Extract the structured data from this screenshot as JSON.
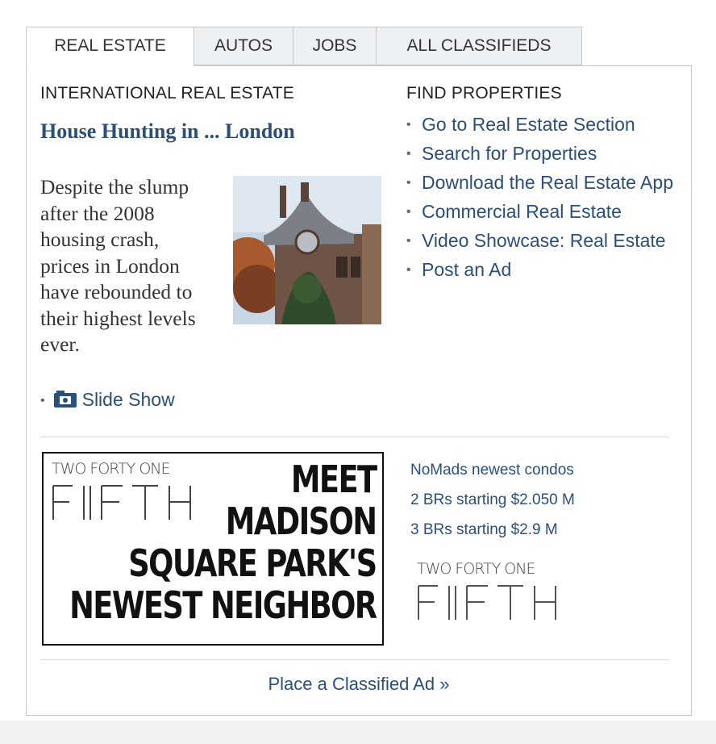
{
  "tabs": [
    {
      "label": "REAL ESTATE"
    },
    {
      "label": "AUTOS"
    },
    {
      "label": "JOBS"
    },
    {
      "label": "ALL CLASSIFIEDS"
    }
  ],
  "feature": {
    "kicker": "INTERNATIONAL REAL ESTATE",
    "headline": "House Hunting in ... London",
    "summary": "Despite the slump after the 2008 housing crash, prices in London have rebounded to their highest levels ever.",
    "slideshow_label": "Slide Show"
  },
  "find_properties": {
    "heading": "FIND PROPERTIES",
    "links": [
      {
        "label": "Go to Real Estate Section"
      },
      {
        "label": "Search for Properties"
      },
      {
        "label": "Download the Real Estate App"
      },
      {
        "label": "Commercial Real Estate"
      },
      {
        "label": "Video Showcase: Real Estate"
      },
      {
        "label": "Post an Ad"
      }
    ]
  },
  "ad": {
    "brand_top": "TWO FORTY ONE",
    "brand_bottom": "FIFTH",
    "headline_lines": [
      "MEET",
      "MADISON",
      "SQUARE PARK'S",
      "NEWEST NEIGHBOR"
    ],
    "promo_lines": [
      "NoMads newest condos",
      "2 BRs starting $2.050 M",
      "3 BRs starting $2.9 M"
    ]
  },
  "footer": {
    "place_ad": "Place a Classified Ad »"
  },
  "colors": {
    "link": "#2a4f78",
    "border": "#c8c8c8",
    "tab_bg": "#eef1f4"
  }
}
